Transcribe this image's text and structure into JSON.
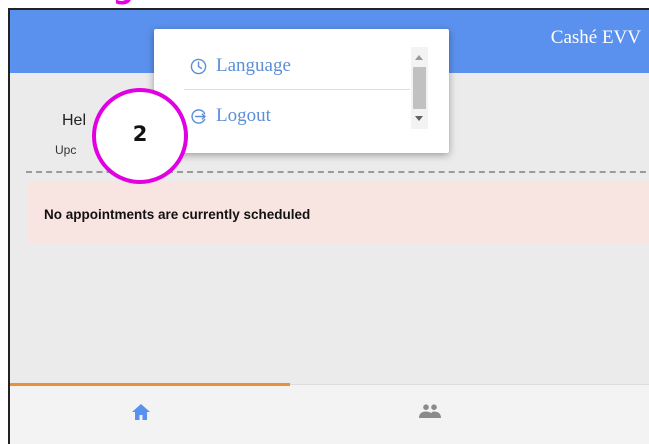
{
  "page_fragment": "ogoo",
  "app": {
    "title": "Cashé EVV"
  },
  "main": {
    "greeting": "Hel",
    "upcoming": "Upc",
    "no_appointments": "No appointments are currently scheduled"
  },
  "menu": {
    "items": [
      {
        "label": "Language",
        "icon": "clock-icon"
      },
      {
        "label": "Logout",
        "icon": "logout-icon"
      }
    ]
  },
  "callout": {
    "number": "2"
  },
  "tabs": [
    {
      "name": "home",
      "icon": "home-icon",
      "active": true
    },
    {
      "name": "people",
      "icon": "people-icon",
      "active": false
    }
  ],
  "colors": {
    "header": "#5b91ee",
    "accent": "#e8913a",
    "menu_text": "#5d8fd6",
    "callout": "#e100e1",
    "notice_bg": "#f8e4e1"
  }
}
